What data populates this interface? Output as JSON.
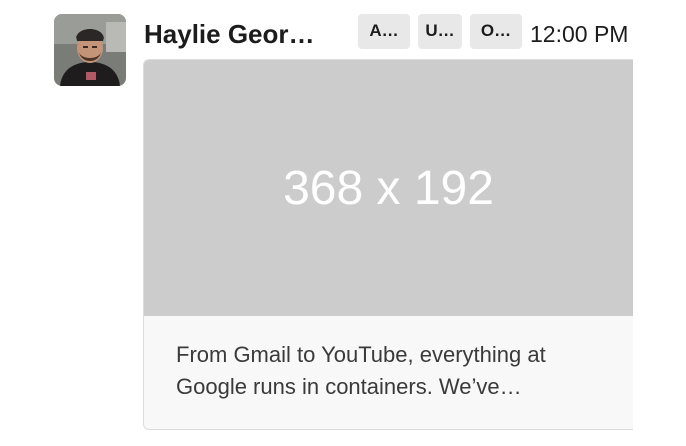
{
  "message": {
    "sender_name": "Haylie Geor…",
    "badges": [
      "A…",
      "U…",
      "O…"
    ],
    "timestamp": "12:00 PM",
    "avatar": {
      "icon": "user-avatar-photo"
    }
  },
  "attachment": {
    "image_placeholder_text": "368 x 192",
    "description": "From Gmail to YouTube, everything at Google runs in containers. We’ve…"
  },
  "colors": {
    "badge_bg": "#e8e8e8",
    "placeholder_bg": "#cccccc",
    "card_bg": "#f8f8f8",
    "text": "#1d1c1d"
  }
}
